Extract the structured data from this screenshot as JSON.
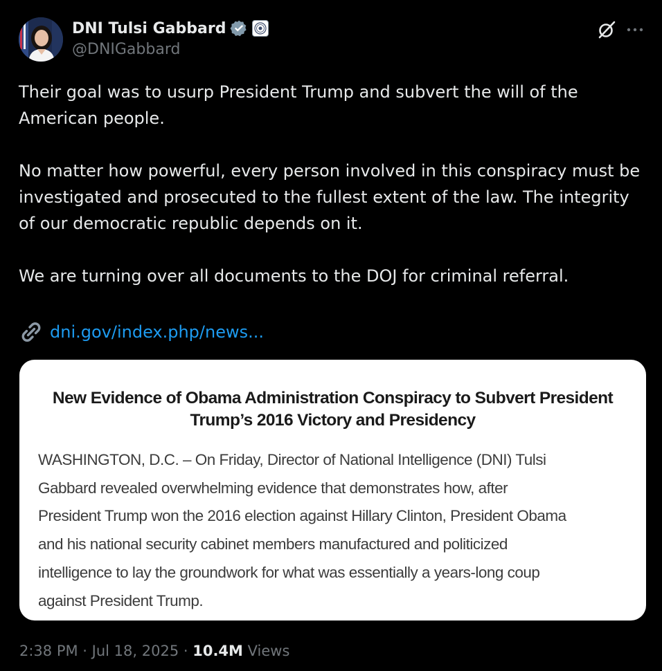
{
  "author": {
    "display_name": "DNI Tulsi Gabbard",
    "handle": "@DNIGabbard",
    "avatar_icon": "profile-photo",
    "verified_icon": "verified-badge-icon",
    "affiliate_icon": "government-seal-icon"
  },
  "actions": {
    "grok_icon": "grok-icon",
    "more_icon": "more-icon"
  },
  "tweet": {
    "paragraphs": [
      "Their goal was to usurp President Trump and subvert the will of the American people.",
      "No matter how powerful, every person involved in this conspiracy must be investigated and prosecuted to the fullest extent of the law. The integrity of our democratic republic depends on it.",
      "We are turning over all documents to the DOJ for criminal referral."
    ],
    "link_icon": "link-icon",
    "link_text": "dni.gov/index.php/news..."
  },
  "card": {
    "title_line1": "New Evidence of Obama Administration Conspiracy to Subvert President",
    "title_line2": "Trump’s 2016 Victory and Presidency",
    "body_lines": [
      "WASHINGTON, D.C. – On Friday, Director of National Intelligence (DNI) Tulsi",
      "Gabbard revealed overwhelming evidence that demonstrates how, after",
      "President Trump won the 2016 election against Hillary Clinton, President Obama",
      "and his national security cabinet members manufactured and politicized",
      "intelligence to lay the groundwork for what was essentially a years-long coup",
      "against President Trump."
    ]
  },
  "meta": {
    "time": "2:38 PM",
    "separator": " · ",
    "date": "Jul 18, 2025",
    "views_count": "10.4M",
    "views_label": " Views"
  },
  "colors": {
    "background": "#000000",
    "text_primary": "#e7e9ea",
    "text_secondary": "#71767b",
    "link": "#1d9bf0",
    "card_background": "#ffffff"
  }
}
